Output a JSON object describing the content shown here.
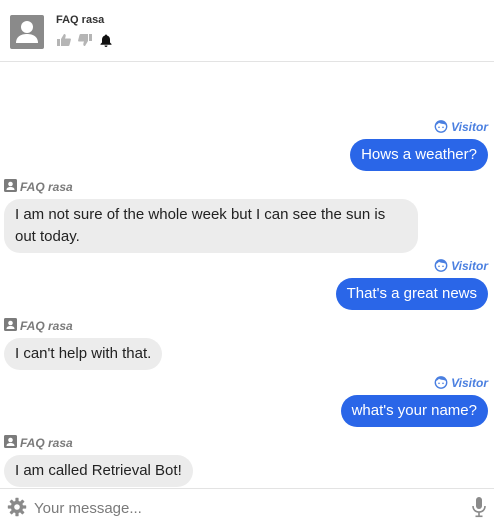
{
  "header": {
    "title": "FAQ rasa",
    "icons": [
      "thumbs-up-icon",
      "thumbs-down-icon",
      "bell-icon"
    ]
  },
  "messages": [
    {
      "sender": "Visitor",
      "text": "Hows a weather?",
      "from": "user"
    },
    {
      "sender": "FAQ rasa",
      "text": "I am not sure of the whole week but I can see the sun is out today.",
      "from": "bot"
    },
    {
      "sender": "Visitor",
      "text": "That's a great news",
      "from": "user"
    },
    {
      "sender": "FAQ rasa",
      "text": "I can't help with that.",
      "from": "bot"
    },
    {
      "sender": "Visitor",
      "text": "what's your name?",
      "from": "user"
    },
    {
      "sender": "FAQ rasa",
      "text": "I am called Retrieval Bot!",
      "from": "bot"
    }
  ],
  "input": {
    "placeholder": "Your message..."
  },
  "colors": {
    "user_bubble": "#2a66e8",
    "bot_bubble": "#ececec",
    "visitor_label": "#4a7fe0",
    "bot_label": "#7b7b7b"
  }
}
